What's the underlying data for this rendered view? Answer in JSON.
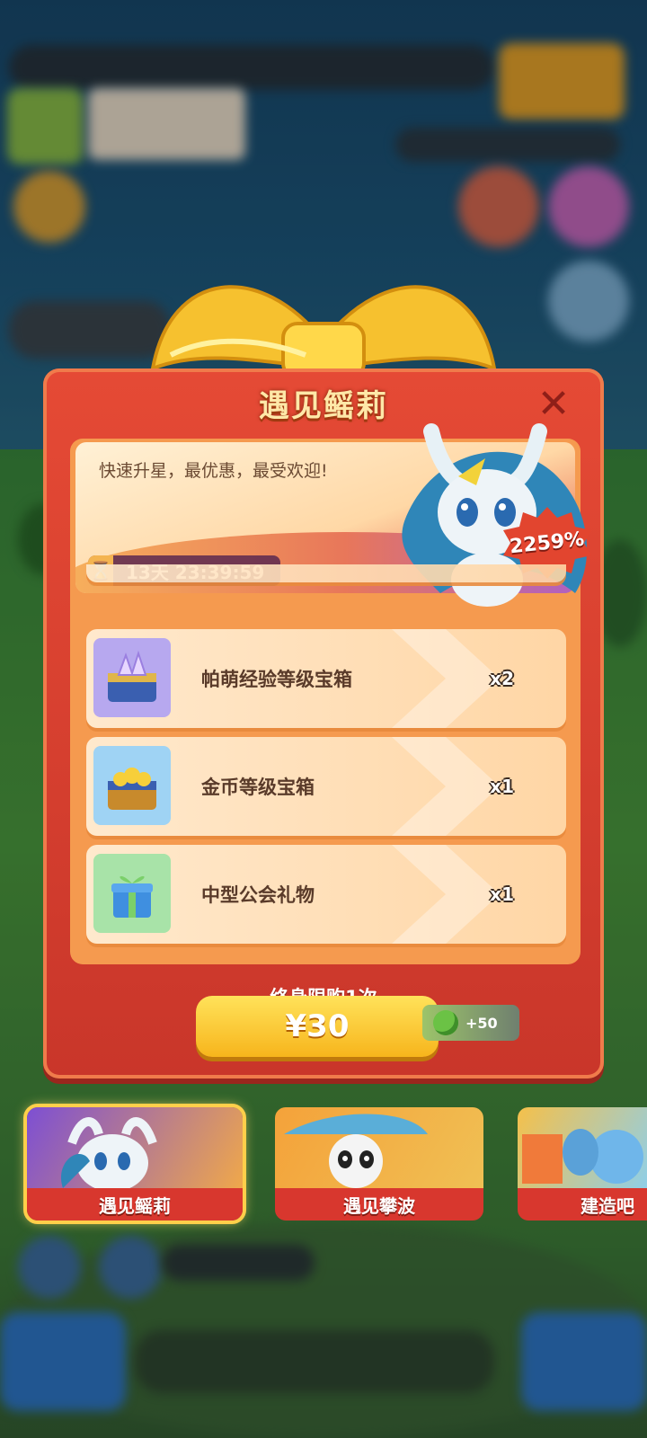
{
  "dialog": {
    "title": "遇见鳐莉",
    "close_label": "✕",
    "description": "快速升星，最优惠，最受欢迎!",
    "timer": "13天 23:39:59",
    "discount": "2259%",
    "items": [
      {
        "name": "帕萌经验等级宝箱",
        "qty": "x2",
        "icon": "crystal-chest-icon"
      },
      {
        "name": "金币等级宝箱",
        "qty": "x1",
        "icon": "gold-chest-icon"
      },
      {
        "name": "中型公会礼物",
        "qty": "x1",
        "icon": "gift-box-icon"
      }
    ],
    "purchase_limit": "终身限购1次",
    "price": "¥30",
    "bonus": "+50"
  },
  "tabs": [
    {
      "label": "遇见鳐莉",
      "selected": true
    },
    {
      "label": "遇见攀波",
      "selected": false
    },
    {
      "label": "建造吧",
      "selected": false
    }
  ],
  "colors": {
    "dialog_red": "#d8372e",
    "button_yellow": "#f7b51c",
    "panel_orange": "#f59a4f"
  }
}
